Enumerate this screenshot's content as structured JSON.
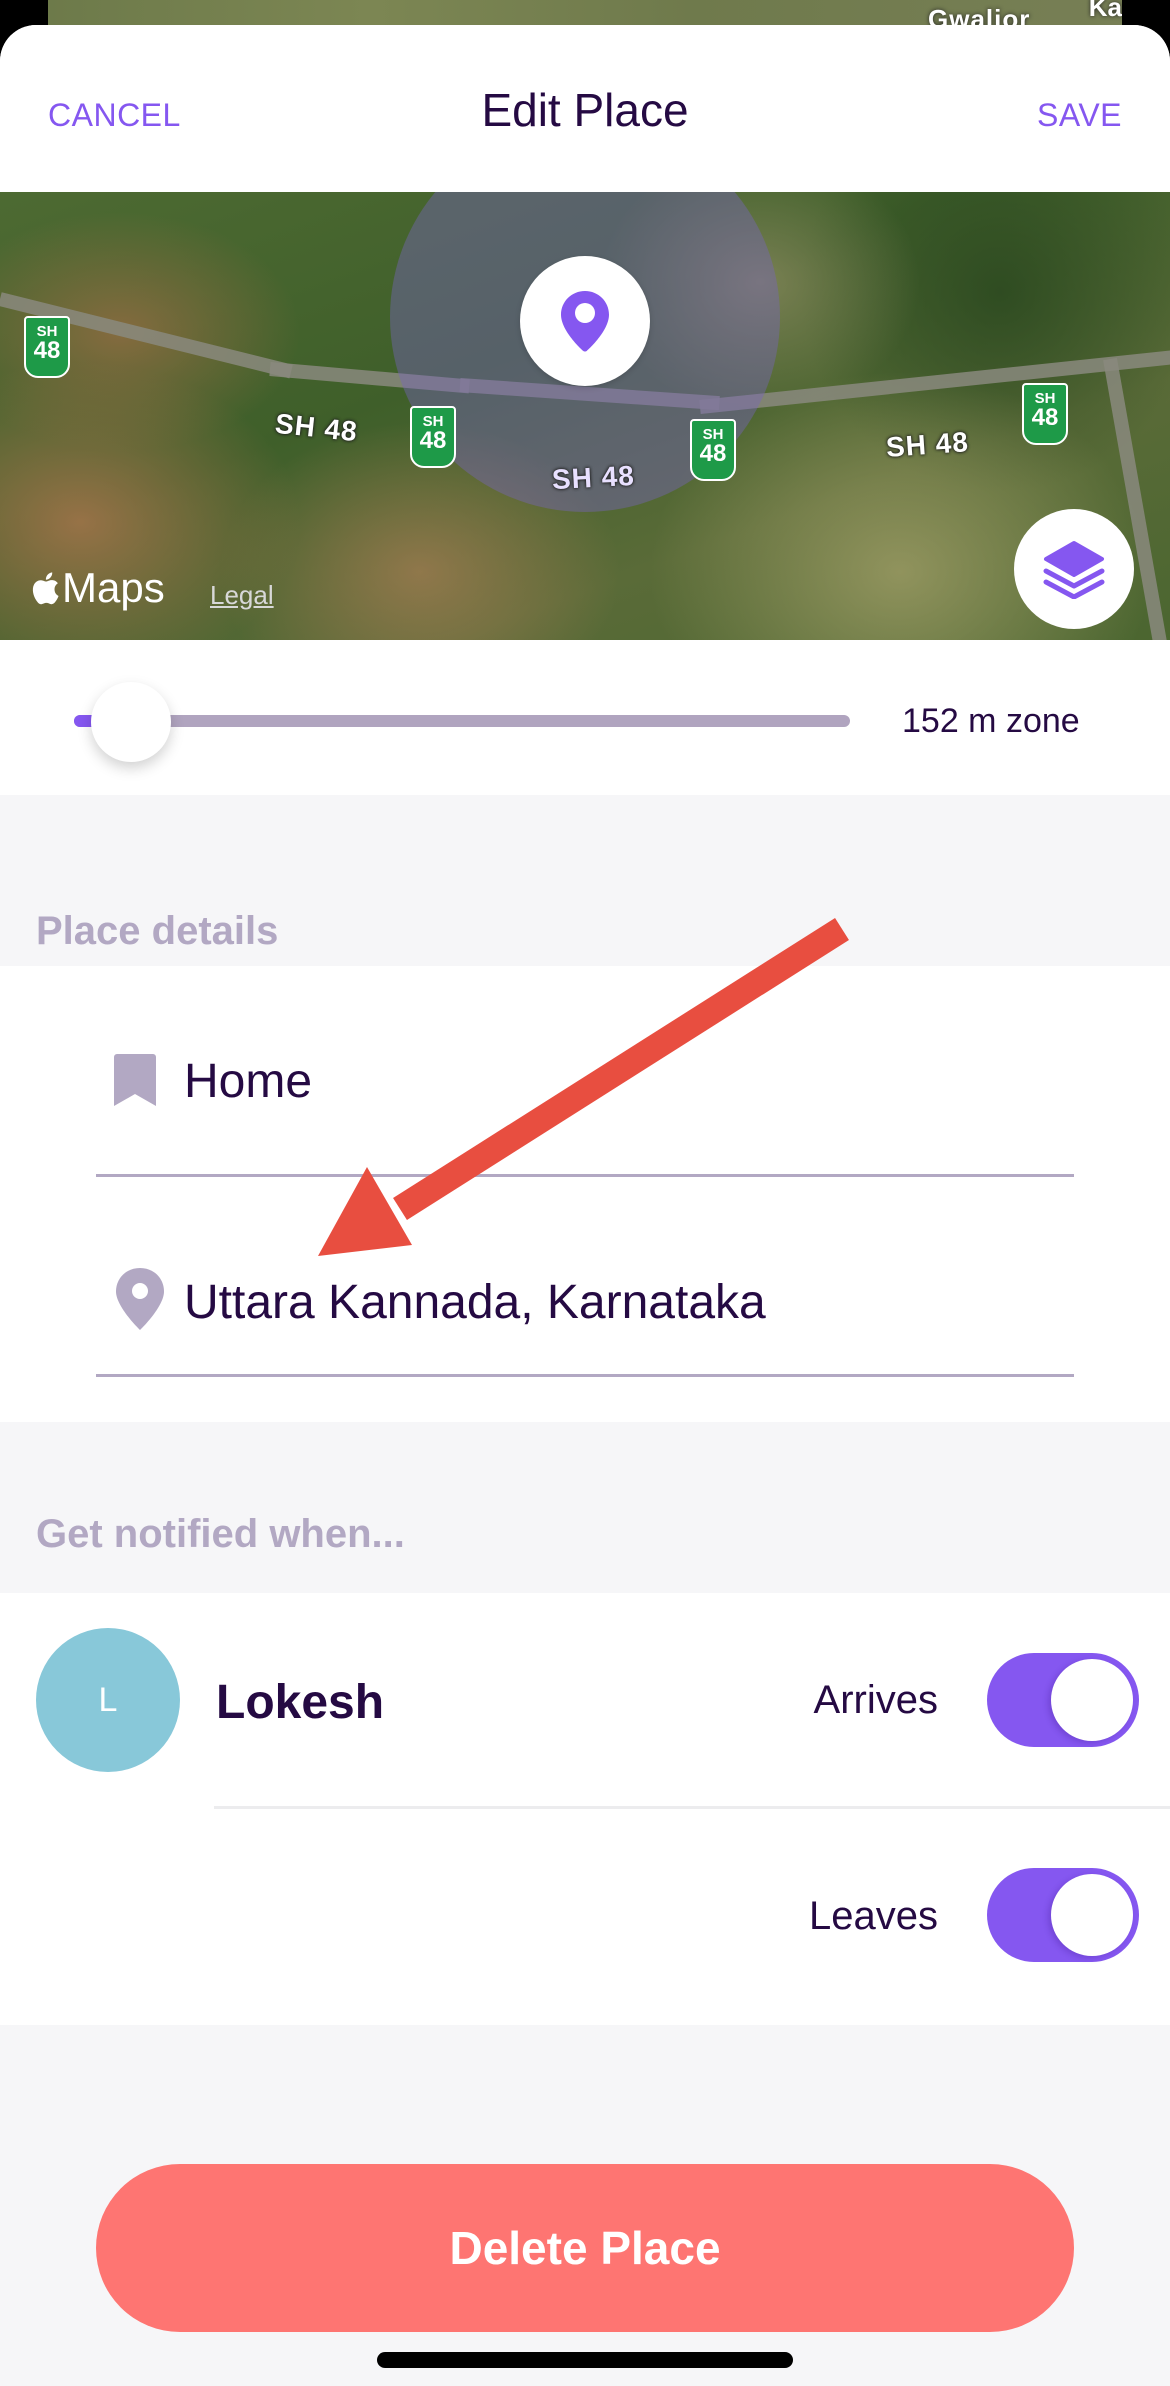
{
  "background_map": {
    "city_label": "Gwalior",
    "city_label_partial": "Ka"
  },
  "header": {
    "cancel_label": "CANCEL",
    "title": "Edit Place",
    "save_label": "SAVE"
  },
  "map": {
    "road_labels": [
      "SH 48",
      "SH 48",
      "SH 48"
    ],
    "shield": {
      "top": "SH",
      "number": "48"
    },
    "attribution": "Maps",
    "legal_label": "Legal",
    "center_icon": "map-pin-icon",
    "layers_icon": "layers-icon"
  },
  "radius_slider": {
    "value_label": "152 m zone",
    "position_fraction": 0.05
  },
  "place_details": {
    "section_title": "Place details",
    "name_field": {
      "value": "Home",
      "icon": "bookmark-icon"
    },
    "address_field": {
      "value": "Uttara Kannada, Karnataka",
      "icon": "location-pin-icon"
    }
  },
  "notifications": {
    "section_title": "Get notified when...",
    "people": [
      {
        "initial": "L",
        "name": "Lokesh",
        "avatar_color": "#88c8d9",
        "toggles": [
          {
            "label": "Arrives",
            "on": true
          },
          {
            "label": "Leaves",
            "on": true
          }
        ]
      }
    ]
  },
  "actions": {
    "delete_label": "Delete Place"
  },
  "colors": {
    "accent": "#8557f0",
    "title_text": "#250a43",
    "section_label": "#b2a8c3",
    "danger": "#fe7572",
    "annotation_arrow": "#e84e40"
  }
}
